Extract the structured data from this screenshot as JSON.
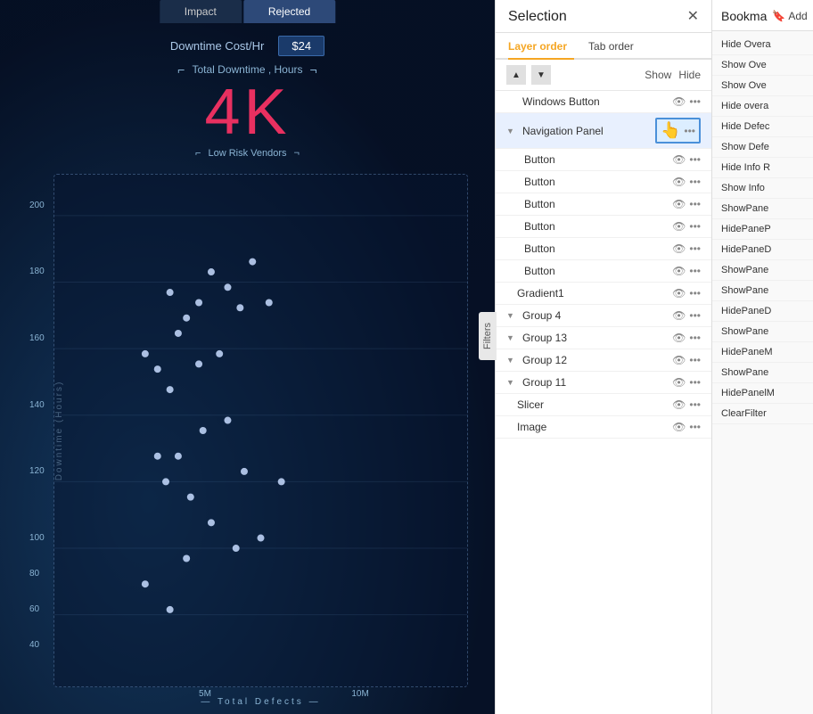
{
  "dashboard": {
    "tabs": [
      {
        "label": "Impact",
        "active": false
      },
      {
        "label": "Rejected",
        "active": false
      }
    ],
    "cost_label": "Downtime Cost/Hr",
    "cost_value": "$24",
    "total_downtime_label": "Total Downtime , Hours",
    "big_number": "4K",
    "low_risk_label": "Low Risk Vendors",
    "y_axis_label": "Downtime (Hours)",
    "x_axis_label": "— Total Defects —",
    "x_ticks": [
      "5M",
      "10M"
    ],
    "y_ticks": [
      "40",
      "60",
      "80",
      "100",
      "120",
      "140",
      "160",
      "180",
      "200"
    ]
  },
  "filters_tab": {
    "label": "Filters"
  },
  "selection": {
    "title": "Selection",
    "close_label": "✕",
    "tabs": [
      {
        "label": "Layer order",
        "active": true
      },
      {
        "label": "Tab order",
        "active": false
      }
    ],
    "controls": {
      "up_arrow": "▲",
      "down_arrow": "▼",
      "show_label": "Show",
      "hide_label": "Hide"
    },
    "layers": [
      {
        "name": "Windows Button",
        "indent": 0,
        "expand": false,
        "selected": false,
        "visible": true
      },
      {
        "name": "Navigation Panel",
        "indent": 0,
        "expand": true,
        "selected": true,
        "visible": true
      },
      {
        "name": "Button",
        "indent": 1,
        "expand": false,
        "selected": false,
        "visible": true
      },
      {
        "name": "Button",
        "indent": 1,
        "expand": false,
        "selected": false,
        "visible": true
      },
      {
        "name": "Button",
        "indent": 1,
        "expand": false,
        "selected": false,
        "visible": true
      },
      {
        "name": "Button",
        "indent": 1,
        "expand": false,
        "selected": false,
        "visible": true
      },
      {
        "name": "Button",
        "indent": 1,
        "expand": false,
        "selected": false,
        "visible": true
      },
      {
        "name": "Button",
        "indent": 1,
        "expand": false,
        "selected": false,
        "visible": true
      },
      {
        "name": "Gradient1",
        "indent": 0,
        "expand": false,
        "selected": false,
        "visible": true
      },
      {
        "name": "Group 4",
        "indent": 0,
        "expand": true,
        "selected": false,
        "visible": true
      },
      {
        "name": "Group 13",
        "indent": 0,
        "expand": true,
        "selected": false,
        "visible": true
      },
      {
        "name": "Group 12",
        "indent": 0,
        "expand": true,
        "selected": false,
        "visible": true
      },
      {
        "name": "Group 11",
        "indent": 0,
        "expand": true,
        "selected": false,
        "visible": true
      },
      {
        "name": "Slicer",
        "indent": 0,
        "expand": false,
        "selected": false,
        "visible": true
      },
      {
        "name": "Image",
        "indent": 0,
        "expand": false,
        "selected": false,
        "visible": true
      }
    ]
  },
  "bookmarks": {
    "title": "Bookma",
    "add_label": "Add",
    "items": [
      {
        "label": "Hide Overa"
      },
      {
        "label": "Show Ove"
      },
      {
        "label": "Show Ove"
      },
      {
        "label": "Hide overa"
      },
      {
        "label": "Hide Defec"
      },
      {
        "label": "Show Defe"
      },
      {
        "label": "Hide Info R"
      },
      {
        "label": "Show Info"
      },
      {
        "label": "ShowPane"
      },
      {
        "label": "HidePaneP"
      },
      {
        "label": "HidePaneD"
      },
      {
        "label": "ShowPane"
      },
      {
        "label": "ShowPane"
      },
      {
        "label": "HidePaneD"
      },
      {
        "label": "ShowPane"
      },
      {
        "label": "HidePaneM"
      },
      {
        "label": "ShowPane"
      },
      {
        "label": "HidePanelM"
      },
      {
        "label": "ClearFilter"
      }
    ]
  }
}
